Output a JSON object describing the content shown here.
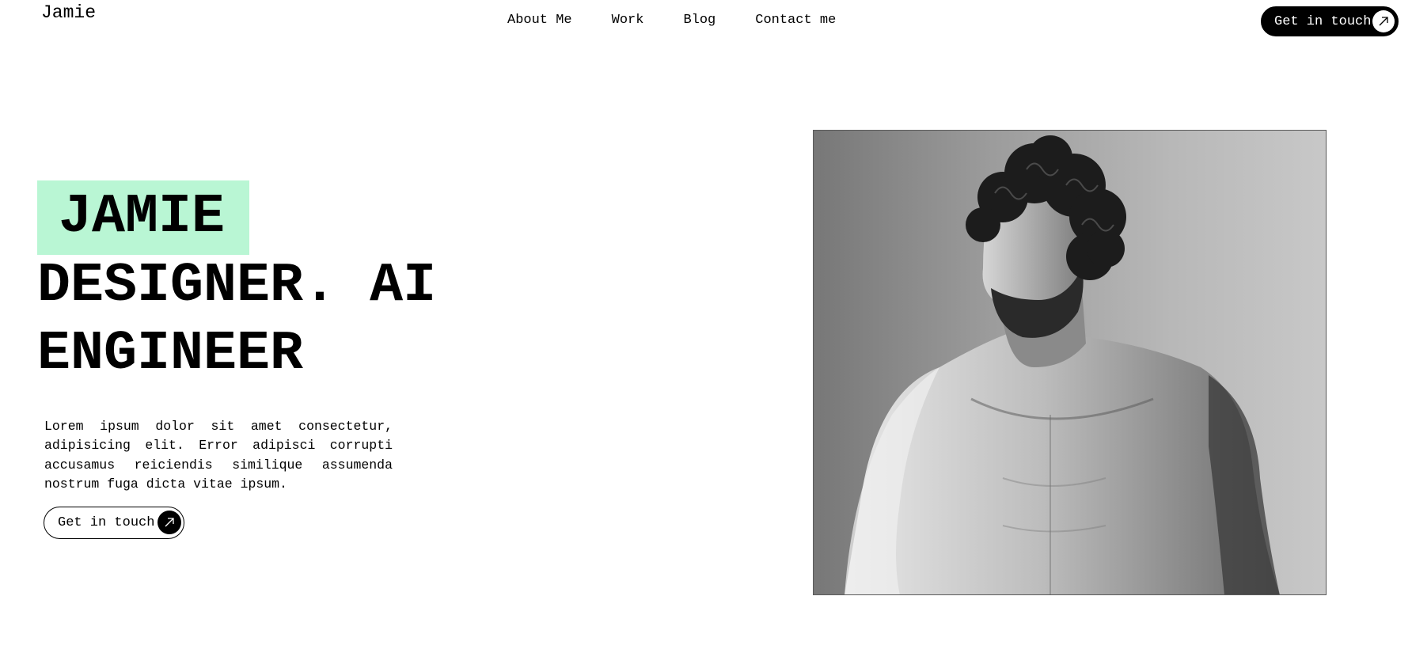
{
  "header": {
    "logo": "Jamie",
    "nav": [
      "About Me",
      "Work",
      "Blog",
      "Contact me"
    ],
    "cta_label": "Get in touch"
  },
  "hero": {
    "highlight_word": "JAMIE",
    "line1": "DESIGNER. AI",
    "line2": "ENGINEER",
    "description": "Lorem ipsum dolor sit amet consectetur, adipisicing elit. Error adipisci corrupti accusamus reiciendis similique assumenda nostrum fuga dicta vitae ipsum.",
    "cta_label": "Get in touch",
    "highlight_color": "#b9f6d4"
  },
  "icons": {
    "cta_arrow": "arrow-up-right-icon"
  }
}
